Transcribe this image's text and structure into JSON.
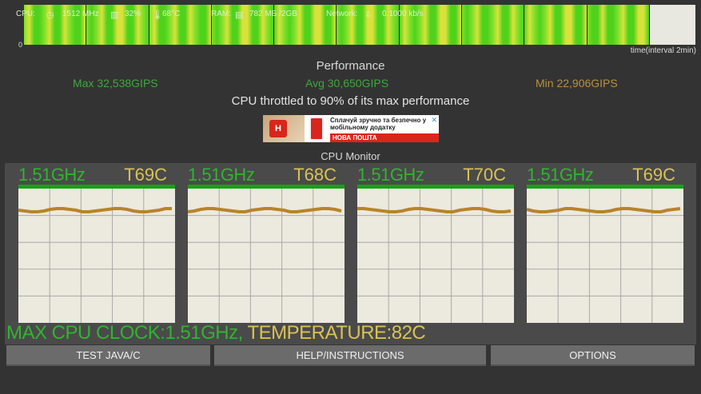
{
  "status": {
    "cpu_label": "CPU:",
    "cpu_freq": "1512 MHz",
    "cpu_load": "32%",
    "cpu_temp": "68°C",
    "ram_label": "RAM:",
    "ram_value": "782 МБ /2GB",
    "network_label": "Network:",
    "network_value": "0.1000 kb/s"
  },
  "graph": {
    "zero_label": "0",
    "time_label": "time(interval 2min)",
    "segment_count": 10
  },
  "performance": {
    "title": "Performance",
    "max": "Max 32,538GIPS",
    "avg": "Avg 30,650GIPS",
    "min": "Min 22,906GIPS",
    "throttle_note": "CPU throttled to 90% of its max performance"
  },
  "ad": {
    "logo_text": "H",
    "text": "Сплачуй зручно та безпечно у мобільному додатку",
    "brand": "НОВА ПОШТА",
    "close": "✕"
  },
  "monitor": {
    "title": "CPU Monitor",
    "cores": [
      {
        "freq": "1.51GHz",
        "temp": "T69C"
      },
      {
        "freq": "1.51GHz",
        "temp": "T68C"
      },
      {
        "freq": "1.51GHz",
        "temp": "T70C"
      },
      {
        "freq": "1.51GHz",
        "temp": "T69C"
      }
    ],
    "max_clock": "MAX CPU CLOCK:1.51GHz,",
    "max_temp": "TEMPERATURE:82C"
  },
  "buttons": {
    "java": "TEST JAVA/C",
    "help": "HELP/INSTRUCTIONS",
    "options": "OPTIONS"
  },
  "colors": {
    "freq_green": "#2fb52f",
    "temp_yellow": "#d9c255",
    "line_orange": "#b8842a"
  }
}
